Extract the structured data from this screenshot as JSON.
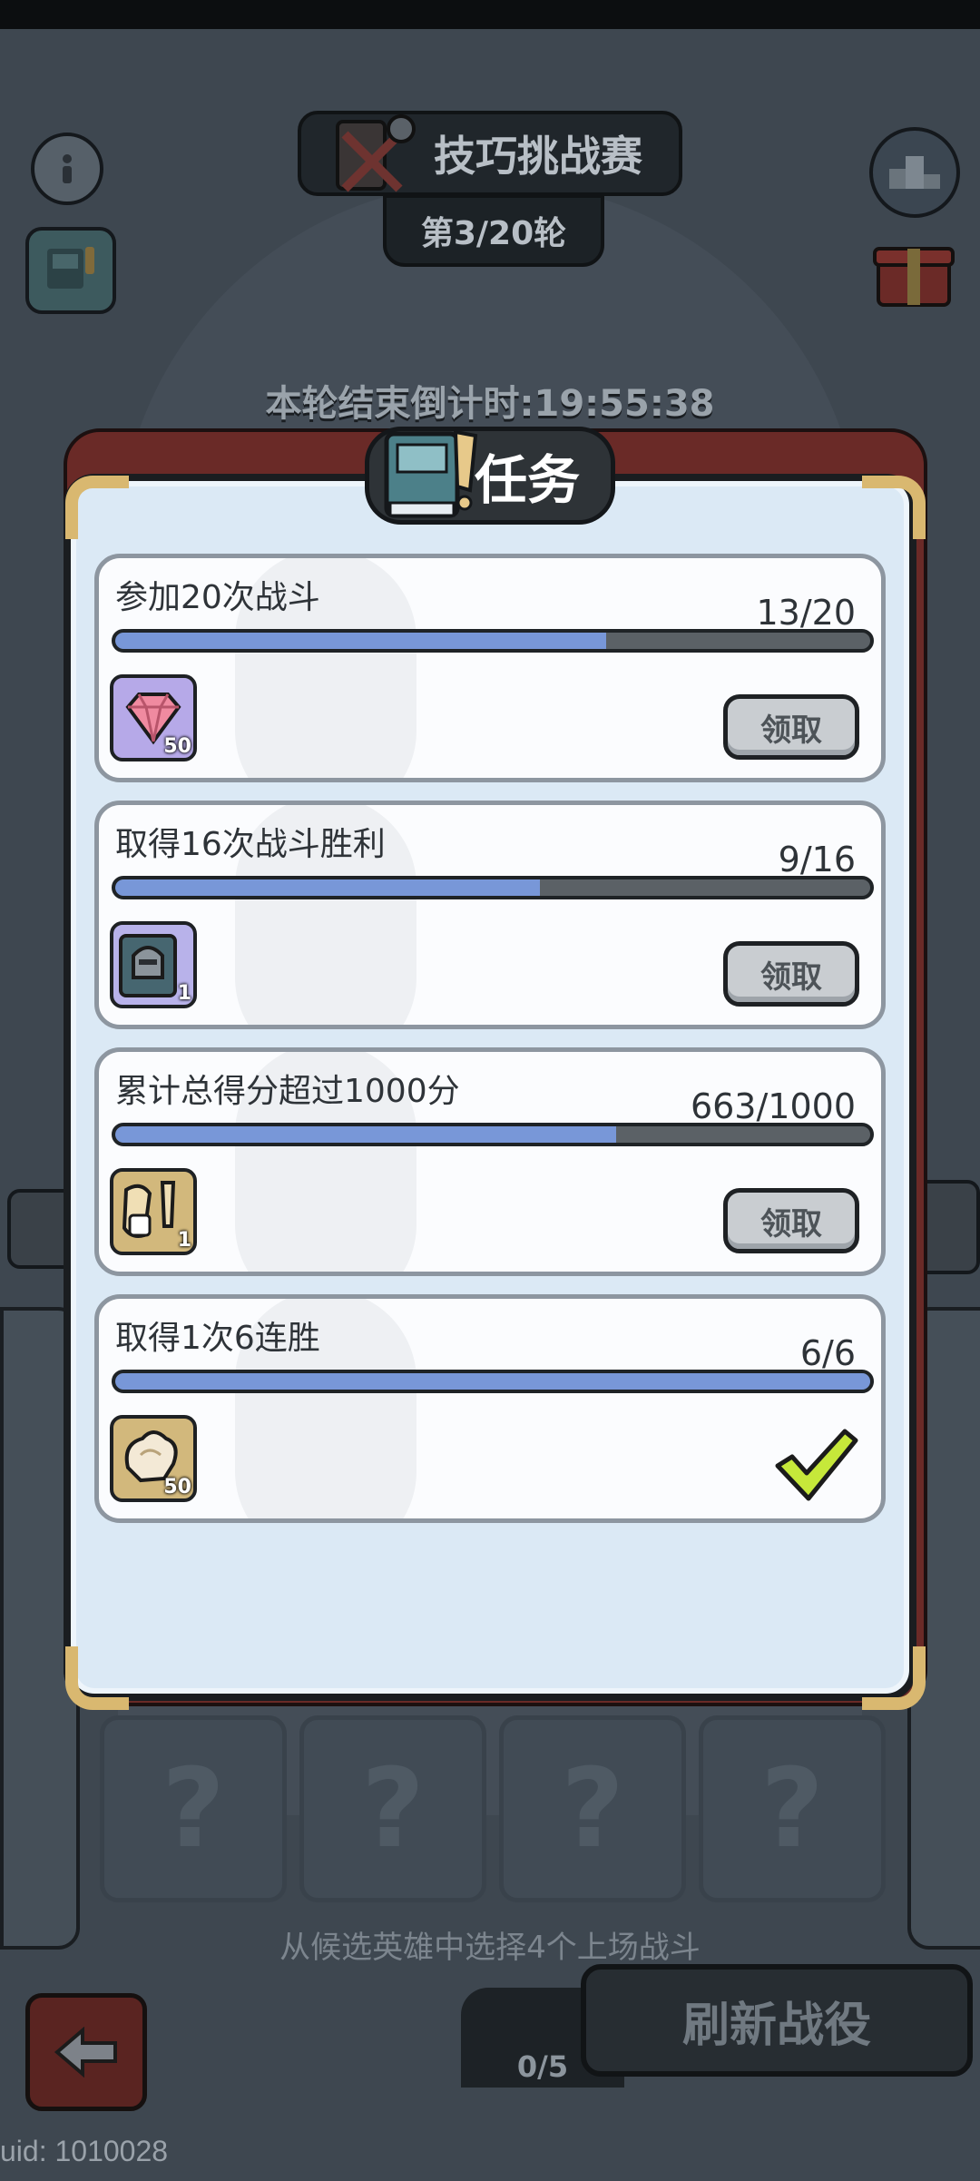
{
  "header": {
    "title": "技巧挑战赛",
    "round": "第3/20轮",
    "countdown": "本轮结束倒计时:19:55:38"
  },
  "modal": {
    "title": "任务",
    "tasks": [
      {
        "name": "参加20次战斗",
        "progress_text": "13/20",
        "progress": 0.65,
        "reward_icon": "gem-icon",
        "reward_qty": "50",
        "action": "领取",
        "completed": false
      },
      {
        "name": "取得16次战斗胜利",
        "progress_text": "9/16",
        "progress": 0.5625,
        "reward_icon": "helmet-card-icon",
        "reward_qty": "1",
        "action": "领取",
        "completed": false
      },
      {
        "name": "累计总得分超过1000分",
        "progress_text": "663/1000",
        "progress": 0.663,
        "reward_icon": "scroll-dice-icon",
        "reward_qty": "1",
        "action": "领取",
        "completed": false
      },
      {
        "name": "取得1次6连胜",
        "progress_text": "6/6",
        "progress": 1.0,
        "reward_icon": "muscle-icon",
        "reward_qty": "50",
        "action": "",
        "completed": true
      }
    ]
  },
  "background": {
    "hint": "从候选英雄中选择4个上场战斗",
    "refresh_button": "刷新战役",
    "hero_count": "0/5",
    "uid": "uid: 1010028"
  },
  "colors": {
    "progress_fill": "#7897d8",
    "panel_bg": "#dbe9f5",
    "check": "#c6e83a"
  }
}
